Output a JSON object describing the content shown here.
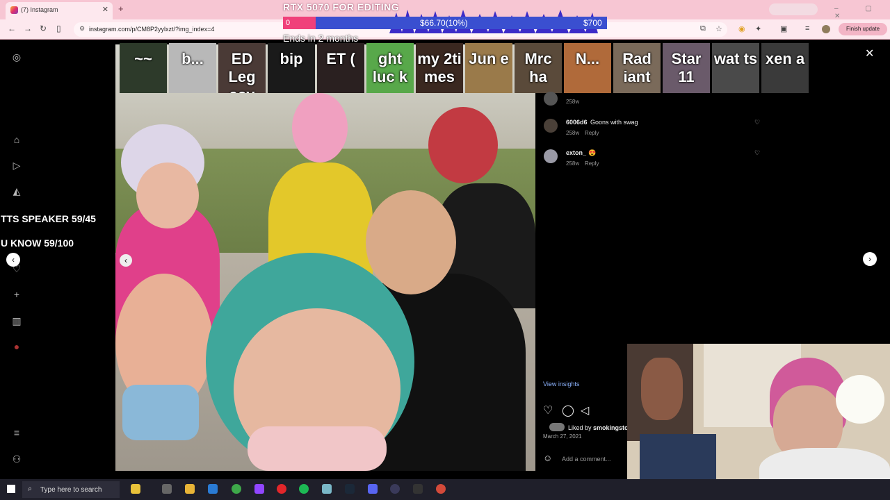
{
  "browser": {
    "tab_title": "(7) Instagram",
    "url": "instagram.com/p/CM8P2yylxzt/?img_index=4",
    "finish_update": "Finish update"
  },
  "overlay": {
    "goal_title": "RTX 5070 FOR EDITING",
    "goal_min": "0",
    "goal_current": "$66.70(10%)",
    "goal_max": "$700",
    "goal_progress": 0.1,
    "goal_ends": "Ends in 2 months",
    "tts_speaker": "TTS SPEAKER 59/45",
    "u_know": "U KNOW 59/100"
  },
  "stickers": [
    {
      "label": "~~"
    },
    {
      "label": "b..."
    },
    {
      "label": "ED Leg acy"
    },
    {
      "label": "bip"
    },
    {
      "label": "ET ("
    },
    {
      "label": "ght luc k"
    },
    {
      "label": "my 2ti mes"
    },
    {
      "label": "Jun e"
    },
    {
      "label": "Mrc ha"
    },
    {
      "label": "N..."
    },
    {
      "label": "Rad iant"
    },
    {
      "label": "Star 11"
    },
    {
      "label": "wat ts"
    },
    {
      "label": "xen a"
    }
  ],
  "comments": [
    {
      "user": "",
      "text": "",
      "time": "258w",
      "reply": ""
    },
    {
      "user": "6006d6",
      "text": "Goons with swag",
      "time": "258w",
      "reply": "Reply"
    },
    {
      "user": "exton_",
      "text": "😍",
      "time": "258w",
      "reply": "Reply"
    }
  ],
  "post": {
    "view_insights": "View insights",
    "liked_by_prefix": "Liked by",
    "liked_by_user": "smokingsto",
    "date": "March 27, 2021",
    "add_comment_placeholder": "Add a comment..."
  },
  "taskbar": {
    "search_placeholder": "Type here to search"
  },
  "icons": {
    "instagram": "instagram-icon",
    "home": "home-icon",
    "reels": "reels-icon",
    "explore": "explore-icon",
    "create": "plus-icon",
    "dashboard": "dashboard-icon",
    "menu": "menu-icon",
    "close": "close-icon"
  },
  "colors": {
    "tab_bar": "#f7c6d3",
    "goal_bar": "#3a4fd0",
    "goal_fill": "#f0407a",
    "insights": "#8db4ff"
  }
}
